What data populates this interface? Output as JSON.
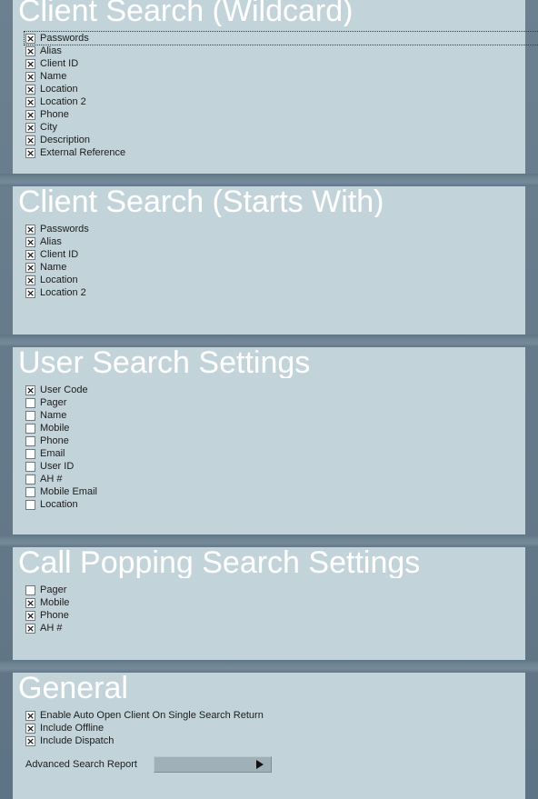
{
  "theme": {
    "page_background": "#5d7486",
    "panel_background": "#c2d3da",
    "divider_color": "#708796",
    "heading_color": "#ffffff",
    "label_color": "#1c1c1c",
    "dropdown_background": "#9fb0b8"
  },
  "sections": [
    {
      "id": "client-search-wildcard",
      "title": "Client Search (Wildcard)",
      "options": [
        {
          "label": "Passwords",
          "checked": true,
          "focused": true
        },
        {
          "label": "Alias",
          "checked": true,
          "focused": false
        },
        {
          "label": "Client ID",
          "checked": true,
          "focused": false
        },
        {
          "label": "Name",
          "checked": true,
          "focused": false
        },
        {
          "label": "Location",
          "checked": true,
          "focused": false
        },
        {
          "label": "Location 2",
          "checked": true,
          "focused": false
        },
        {
          "label": "Phone",
          "checked": true,
          "focused": false
        },
        {
          "label": "City",
          "checked": true,
          "focused": false
        },
        {
          "label": "Description",
          "checked": true,
          "focused": false
        },
        {
          "label": "External Reference",
          "checked": true,
          "focused": false
        }
      ]
    },
    {
      "id": "client-search-starts-with",
      "title": "Client Search (Starts With)",
      "options": [
        {
          "label": "Passwords",
          "checked": true,
          "focused": false
        },
        {
          "label": "Alias",
          "checked": true,
          "focused": false
        },
        {
          "label": "Client ID",
          "checked": true,
          "focused": false
        },
        {
          "label": "Name",
          "checked": true,
          "focused": false
        },
        {
          "label": "Location",
          "checked": true,
          "focused": false
        },
        {
          "label": "Location 2",
          "checked": true,
          "focused": false
        }
      ]
    },
    {
      "id": "user-search-settings",
      "title": "User Search Settings",
      "options": [
        {
          "label": "User Code",
          "checked": true,
          "focused": false
        },
        {
          "label": "Pager",
          "checked": false,
          "focused": false
        },
        {
          "label": "Name",
          "checked": false,
          "focused": false
        },
        {
          "label": "Mobile",
          "checked": false,
          "focused": false
        },
        {
          "label": "Phone",
          "checked": false,
          "focused": false
        },
        {
          "label": "Email",
          "checked": false,
          "focused": false
        },
        {
          "label": "User ID",
          "checked": false,
          "focused": false
        },
        {
          "label": "AH #",
          "checked": false,
          "focused": false
        },
        {
          "label": "Mobile Email",
          "checked": false,
          "focused": false
        },
        {
          "label": "Location",
          "checked": false,
          "focused": false
        }
      ]
    },
    {
      "id": "call-popping-search-settings",
      "title": "Call Popping Search Settings",
      "options": [
        {
          "label": "Pager",
          "checked": false,
          "focused": false
        },
        {
          "label": "Mobile",
          "checked": true,
          "focused": false
        },
        {
          "label": "Phone",
          "checked": true,
          "focused": false
        },
        {
          "label": "AH #",
          "checked": true,
          "focused": false
        }
      ]
    },
    {
      "id": "general",
      "title": "General",
      "options": [
        {
          "label": "Enable Auto Open Client On Single Search Return",
          "checked": true,
          "focused": false
        },
        {
          "label": "Include Offline",
          "checked": true,
          "focused": false
        },
        {
          "label": "Include Dispatch",
          "checked": true,
          "focused": false
        }
      ],
      "field": {
        "label": "Advanced Search Report",
        "value": "",
        "icon": "chevron-right-icon"
      }
    }
  ]
}
